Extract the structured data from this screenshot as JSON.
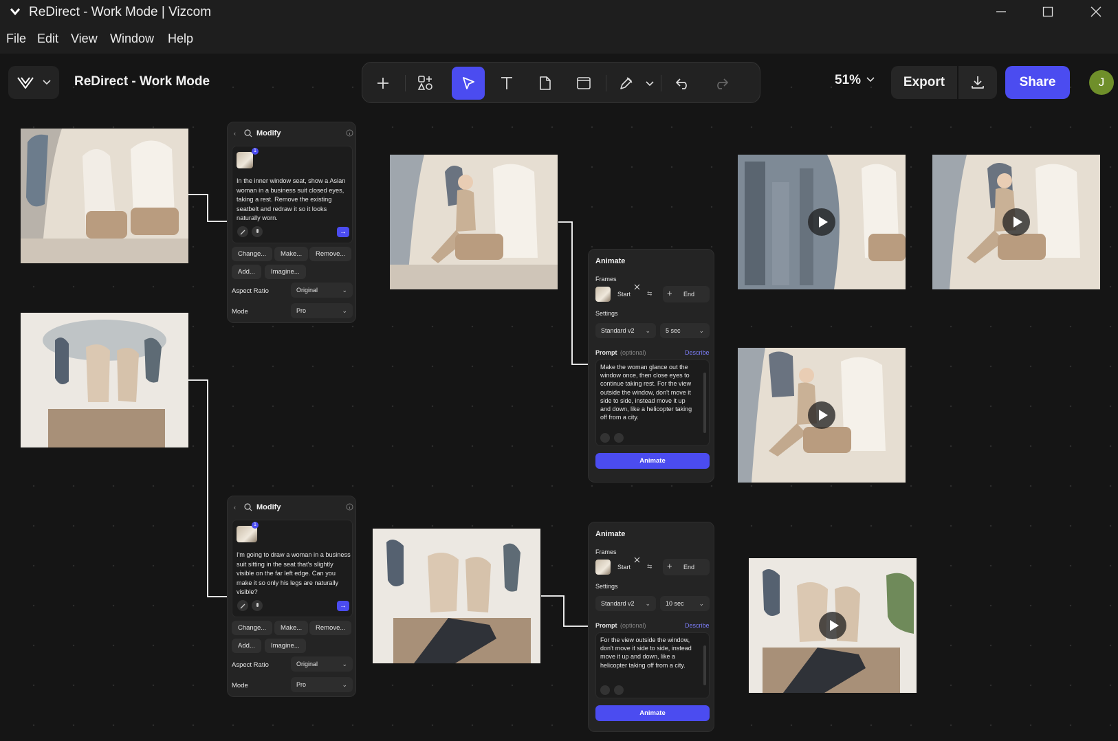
{
  "window": {
    "title": "ReDirect - Work Mode | Vizcom"
  },
  "menu": [
    "File",
    "Edit",
    "View",
    "Window",
    "Help"
  ],
  "header": {
    "project_name": "ReDirect - Work Mode",
    "zoom": "51%",
    "export_label": "Export",
    "share_label": "Share",
    "avatar_initial": "J"
  },
  "modify_panels": [
    {
      "title": "Modify",
      "badge": "1",
      "prompt": "In the inner window seat, show a Asian woman in a business suit closed eyes, taking a rest. Remove the existing seatbelt and redraw it so it looks naturally worn.",
      "chips": [
        "Change...",
        "Make...",
        "Remove...",
        "Add...",
        "Imagine..."
      ],
      "aspect_label": "Aspect Ratio",
      "aspect_value": "Original",
      "mode_label": "Mode",
      "mode_value": "Pro"
    },
    {
      "title": "Modify",
      "badge": "1",
      "prompt": "I'm going to draw a woman in a business suit sitting in the seat that's slightly visible on the far left edge. Can you make it so only his legs are naturally visible?",
      "chips": [
        "Change...",
        "Make...",
        "Remove...",
        "Add...",
        "Imagine..."
      ],
      "aspect_label": "Aspect Ratio",
      "aspect_value": "Original",
      "mode_label": "Mode",
      "mode_value": "Pro"
    }
  ],
  "animate_panels": [
    {
      "title": "Animate",
      "frames_label": "Frames",
      "start_label": "Start",
      "end_label": "End",
      "settings_label": "Settings",
      "model": "Standard v2",
      "duration": "5 sec",
      "prompt_label": "Prompt",
      "prompt_optional": "(optional)",
      "describe": "Describe",
      "prompt": "Make the woman glance out the window once, then close eyes to continue taking rest. For the view outside the window, don't move it side to side, instead move it up and down, like a helicopter taking off from a city.",
      "button": "Animate"
    },
    {
      "title": "Animate",
      "frames_label": "Frames",
      "start_label": "Start",
      "end_label": "End",
      "settings_label": "Settings",
      "model": "Standard v2",
      "duration": "10 sec",
      "prompt_label": "Prompt",
      "prompt_optional": "(optional)",
      "describe": "Describe",
      "prompt": "For the view outside the window, don't move it side to side, instead move it up and down, like a helicopter taking off from a city.",
      "button": "Animate"
    }
  ],
  "colors": {
    "accent": "#4b4cf0",
    "canvas": "#151515",
    "panel": "#242424"
  }
}
